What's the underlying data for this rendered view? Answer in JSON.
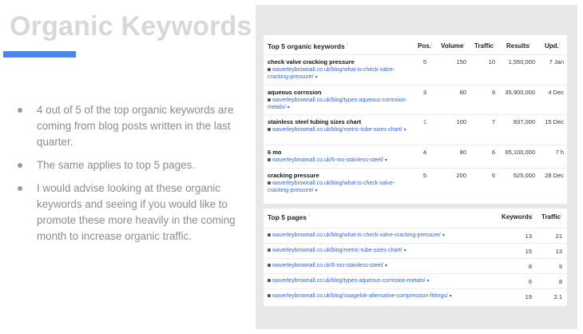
{
  "slide": {
    "title": "Organic Keywords",
    "bullets": [
      "4 out of 5 of the top organic keywords are coming from blog posts written in the last quarter.",
      "The same applies to top 5 pages.",
      "I would advise looking at these organic keywords and seeing if you would like to promote these more heavily in the coming month to increase organic traffic."
    ],
    "accent_color": "#4a86e8"
  },
  "keywords_card": {
    "title": "Top 5 organic keywords",
    "columns": {
      "pos": "Pos.",
      "volume": "Volume",
      "traffic": "Traffic",
      "results": "Results",
      "upd": "Upd."
    },
    "rows": [
      {
        "keyword": "check valve cracking pressure",
        "url": "waverleybrownall.co.uk/blog/what-is-check-valve-cracking-pressure/",
        "pos": "5",
        "volume": "150",
        "traffic": "10",
        "results": "1,550,000",
        "upd": "7 Jan"
      },
      {
        "keyword": "aqueous corrosion",
        "url": "waverleybrownall.co.uk/blog/types-aqueous-corrosion-metals/",
        "pos": "3",
        "volume": "80",
        "traffic": "9",
        "results": "35,900,000",
        "upd": "4 Dec"
      },
      {
        "keyword": "stainless steel tubing sizes chart",
        "url": "waverleybrownall.co.uk/blog/metric-tube-sizes-chart/",
        "pos": "1",
        "volume": "100",
        "traffic": "7",
        "results": "837,000",
        "upd": "15 Dec"
      },
      {
        "keyword": "6 mo",
        "url": "waverleybrownall.co.uk/6-mo-stainless-steel/",
        "pos": "4",
        "volume": "80",
        "traffic": "6",
        "results": "65,100,000",
        "upd": "7 h"
      },
      {
        "keyword": "cracking pressure",
        "url": "waverleybrownall.co.uk/blog/what-is-check-valve-cracking-pressure/",
        "pos": "5",
        "volume": "200",
        "traffic": "6",
        "results": "525,000",
        "upd": "28 Dec"
      }
    ]
  },
  "pages_card": {
    "title": "Top 5 pages",
    "columns": {
      "keywords": "Keywords",
      "traffic": "Traffic"
    },
    "rows": [
      {
        "url": "waverleybrownall.co.uk/blog/what-is-check-valve-cracking-pressure/",
        "keywords": "13",
        "traffic": "21"
      },
      {
        "url": "waverleybrownall.co.uk/blog/metric-tube-sizes-chart/",
        "keywords": "15",
        "traffic": "13"
      },
      {
        "url": "waverleybrownall.co.uk/6-mo-stainless-steel/",
        "keywords": "8",
        "traffic": "9"
      },
      {
        "url": "waverleybrownall.co.uk/blog/types-aqueous-corrosion-metals/",
        "keywords": "6",
        "traffic": "8"
      },
      {
        "url": "waverleybrownall.co.uk/blog/swagelok-alternative-compression-fittings/",
        "keywords": "19",
        "traffic": "2.1"
      }
    ]
  }
}
